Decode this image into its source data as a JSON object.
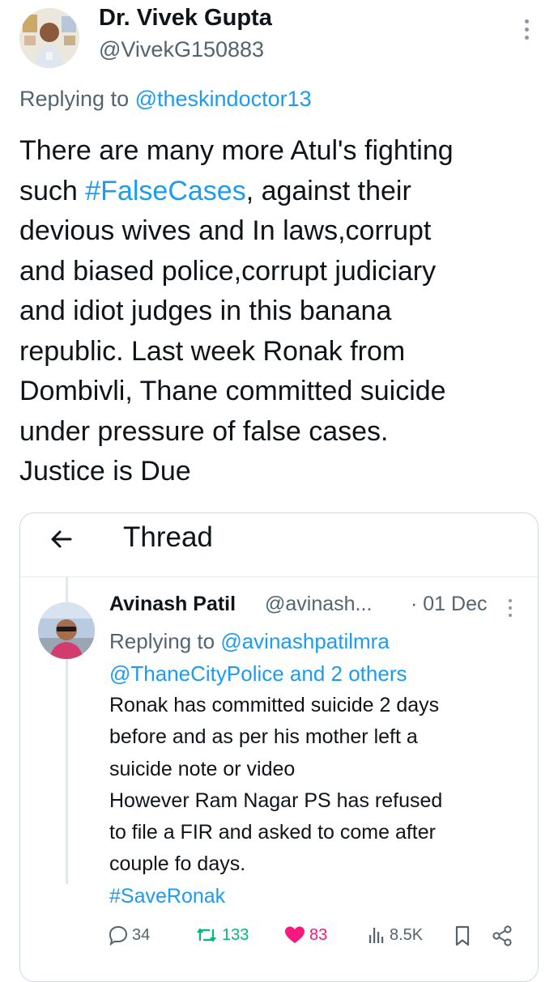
{
  "tweet": {
    "author_name": "Dr. Vivek Gupta",
    "author_handle": "@VivekG150883",
    "replying_prefix": "Replying to ",
    "replying_to": "@theskindoctor13",
    "text_lines": [
      [
        "There are many more Atul's fighting",
        "",
        ""
      ],
      [
        "such ",
        "#FalseCases",
        ", against their"
      ],
      [
        "devious wives and In laws,corrupt",
        "",
        ""
      ],
      [
        "and biased police,corrupt judiciary",
        "",
        ""
      ],
      [
        "and idiot judges in this banana",
        "",
        ""
      ],
      [
        "republic. Last week Ronak from",
        "",
        ""
      ],
      [
        "Dombivli, Thane committed suicide",
        "",
        ""
      ],
      [
        "under pressure of false cases.",
        "",
        ""
      ],
      [
        "Justice is Due",
        "",
        ""
      ]
    ]
  },
  "quote": {
    "header_title": "Thread",
    "author_name": "Avinash Patil",
    "author_handle": "@avinash...",
    "date": "· 01 Dec",
    "replying_prefix": "Replying to ",
    "replying_to_1": "@avinashpatilmra",
    "replying_to_2": "@ThaneCityPolice and 2 others",
    "text_lines": [
      "Ronak has committed suicide 2 days",
      "before and as per his mother left a",
      "suicide note or video",
      "However Ram Nagar PS has refused",
      "to file a FIR and asked to come after",
      "couple fo days."
    ],
    "hashtag": "#SaveRonak",
    "stats": {
      "replies": "34",
      "reposts": "133",
      "likes": "83",
      "views": "8.5K"
    }
  },
  "colors": {
    "link": "#1d9bf0",
    "repost": "#00ba7c",
    "like": "#f91880",
    "muted": "#536471"
  },
  "icons": {
    "back": "arrow-left-icon",
    "more": "more-vertical-icon",
    "reply": "speech-bubble-icon",
    "repost": "repost-icon",
    "like": "heart-icon",
    "views": "bar-chart-icon",
    "bookmark": "bookmark-icon",
    "share": "share-icon"
  }
}
